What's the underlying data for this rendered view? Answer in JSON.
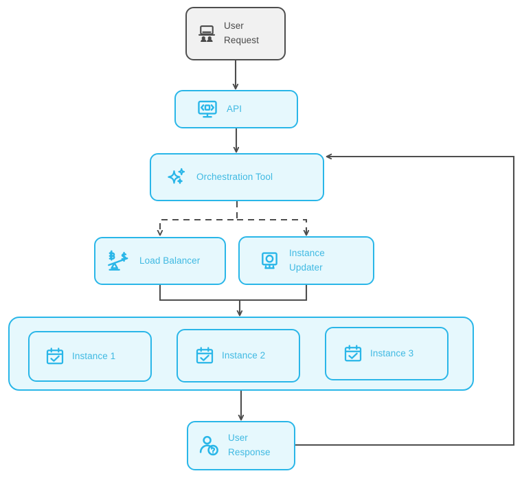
{
  "diagram": {
    "title": "Orchestration architecture flow",
    "colors": {
      "node_fill": "#e6f8fd",
      "node_border": "#29b6e8",
      "node_text": "#3fb9e2",
      "start_fill": "#f1f1f1",
      "start_border": "#4d4d4d",
      "start_text": "#4a4a4a",
      "edge": "#4d4d4d",
      "background": "#ffffff"
    },
    "nodes": [
      {
        "id": "user-request",
        "label": "User\nRequest",
        "icon": "laptop-users-icon",
        "style": "gray"
      },
      {
        "id": "api",
        "label": "API",
        "icon": "api-monitor-code-icon",
        "style": "cyan"
      },
      {
        "id": "orchestration-tool",
        "label": "Orchestration Tool",
        "icon": "sparkles-icon",
        "style": "cyan"
      },
      {
        "id": "load-balancer",
        "label": "Load Balancer",
        "icon": "balance-scale-icon",
        "style": "cyan"
      },
      {
        "id": "instance-updater",
        "label": "Instance\nUpdater",
        "icon": "monitor-circle-icon",
        "style": "cyan"
      },
      {
        "id": "instance-1",
        "label": "Instance 1",
        "icon": "calendar-check-icon",
        "style": "cyan"
      },
      {
        "id": "instance-2",
        "label": "Instance 2",
        "icon": "calendar-check-icon",
        "style": "cyan"
      },
      {
        "id": "instance-3",
        "label": "Instance 3",
        "icon": "calendar-check-icon",
        "style": "cyan"
      },
      {
        "id": "user-response",
        "label": "User\nResponse",
        "icon": "user-question-icon",
        "style": "cyan"
      }
    ],
    "groups": [
      {
        "id": "instances-group",
        "label": "",
        "contains": [
          "instance-1",
          "instance-2",
          "instance-3"
        ]
      }
    ],
    "edges": [
      {
        "from": "user-request",
        "to": "api",
        "style": "solid",
        "arrow": true
      },
      {
        "from": "api",
        "to": "orchestration-tool",
        "style": "solid",
        "arrow": true
      },
      {
        "from": "orchestration-tool",
        "to": "load-balancer",
        "style": "dashed",
        "arrow": true
      },
      {
        "from": "orchestration-tool",
        "to": "instance-updater",
        "style": "dashed",
        "arrow": true
      },
      {
        "from": "load-balancer",
        "to": "instances-group",
        "style": "solid",
        "arrow": true
      },
      {
        "from": "instance-updater",
        "to": "instances-group",
        "style": "solid",
        "arrow": true
      },
      {
        "from": "instances-group",
        "to": "user-response",
        "style": "solid",
        "arrow": true
      },
      {
        "from": "user-response",
        "to": "orchestration-tool",
        "style": "solid",
        "arrow": true
      }
    ]
  }
}
